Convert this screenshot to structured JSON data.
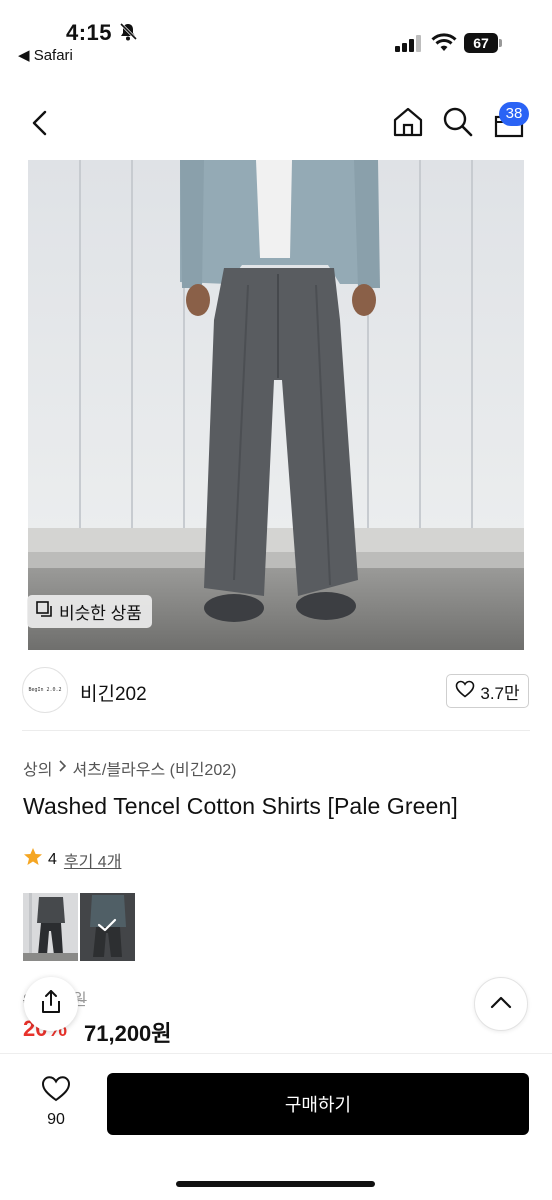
{
  "status_bar": {
    "time": "4:15",
    "back_app": "◀ Safari",
    "battery": "67"
  },
  "header": {
    "cart_count": "38",
    "icons": [
      "back-icon",
      "home-icon",
      "search-icon",
      "cart-icon"
    ]
  },
  "image": {
    "similar_label": "비슷한 상품"
  },
  "brand": {
    "logo_text": "BegIn 2.0.2",
    "name": "비긴202",
    "likes": "3.7만"
  },
  "product": {
    "category_main": "상의",
    "category_sub": "셔츠/블라우스 (비긴202)",
    "title": "Washed Tencel Cotton Shirts [Pale Green]",
    "rating": "4",
    "review_label": "후기 4개",
    "original_price": "89,000원",
    "discount": "20%",
    "price": "71,200원"
  },
  "bottom_bar": {
    "wish_count": "90",
    "buy_label": "구매하기"
  },
  "colors": {
    "accent_badge": "#2a63f5",
    "discount": "#e8322b",
    "star": "#f5a623",
    "buy_button": "#000000"
  }
}
